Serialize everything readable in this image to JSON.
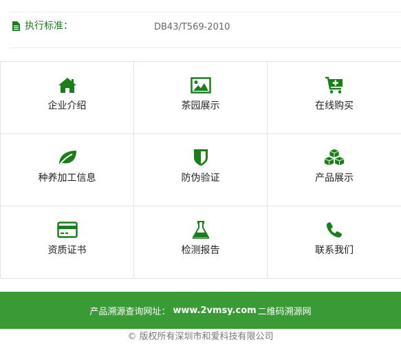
{
  "standard": {
    "label": "执行标准：",
    "value": "DB43/T569-2010"
  },
  "grid": [
    {
      "label": "企业介绍",
      "icon": "home-icon"
    },
    {
      "label": "茶园展示",
      "icon": "image-icon"
    },
    {
      "label": "在线购买",
      "icon": "cart-icon"
    },
    {
      "label": "种养加工信息",
      "icon": "leaf-icon"
    },
    {
      "label": "防伪验证",
      "icon": "shield-icon"
    },
    {
      "label": "产品展示",
      "icon": "cubes-icon"
    },
    {
      "label": "资质证书",
      "icon": "credit-card-icon"
    },
    {
      "label": "检测报告",
      "icon": "flask-icon"
    },
    {
      "label": "联系我们",
      "icon": "phone-icon"
    }
  ],
  "footer": {
    "prefix": "产品溯源查询网址：",
    "url": "www.2vmsy.com",
    "suffix": "二维码溯源网",
    "copyright": "© 版权所有深圳市和爱科技有限公司"
  },
  "colors": {
    "brand_green": "#1a7f1a",
    "footer_green": "#3a9a35"
  }
}
